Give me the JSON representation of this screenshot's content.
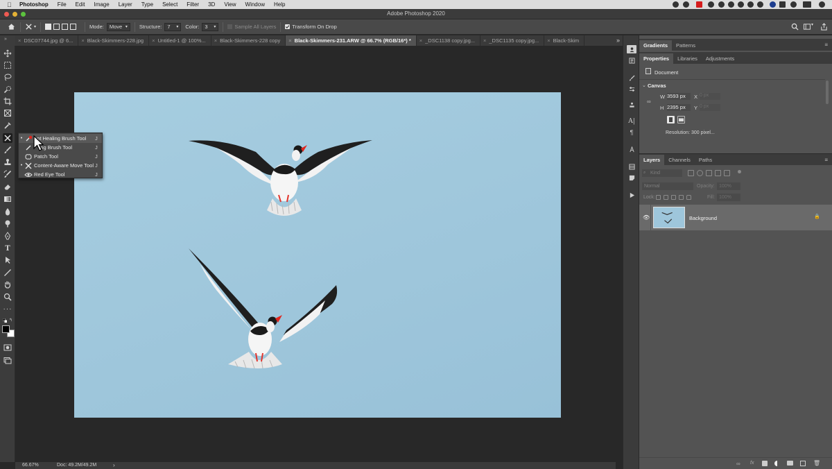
{
  "menubar": {
    "app_name": "Photoshop",
    "items": [
      "File",
      "Edit",
      "Image",
      "Layer",
      "Type",
      "Select",
      "Filter",
      "3D",
      "View",
      "Window",
      "Help"
    ]
  },
  "window": {
    "title": "Adobe Photoshop 2020"
  },
  "options": {
    "mode_label": "Mode:",
    "mode_value": "Move",
    "structure_label": "Structure:",
    "structure_value": "7",
    "color_label": "Color:",
    "color_value": "3",
    "sample_all_layers": "Sample All Layers",
    "transform_on_drop": "Transform On Drop"
  },
  "tabs": [
    {
      "label": "DSC07744.jpg @ 6..."
    },
    {
      "label": "Black-Skimmers-228.jpg"
    },
    {
      "label": "Untitled-1 @ 100%..."
    },
    {
      "label": "Black-Skimmers-228 copy"
    },
    {
      "label": "Black-Skimmers-231.ARW @ 66.7% (RGB/16*) *"
    },
    {
      "label": "_DSC1138 copy.jpg..."
    },
    {
      "label": "_DSC1135 copy.jpg..."
    },
    {
      "label": "Black-Skim"
    }
  ],
  "flyout": {
    "items": [
      {
        "label": "Spot Healing Brush Tool",
        "visible_text": "pot Healing Brush Tool",
        "key": "J",
        "selected": true,
        "icon": "spot-healing-icon"
      },
      {
        "label": "Healing Brush Tool",
        "visible_text": "ling Brush Tool",
        "key": "J",
        "selected": false,
        "icon": "healing-brush-icon"
      },
      {
        "label": "Patch Tool",
        "visible_text": "Patch Tool",
        "key": "J",
        "selected": false,
        "icon": "patch-icon"
      },
      {
        "label": "Content-Aware Move Tool",
        "visible_text": "Content-Aware Move Tool",
        "key": "J",
        "selected": true,
        "icon": "content-aware-move-icon"
      },
      {
        "label": "Red Eye Tool",
        "visible_text": "Red Eye Tool",
        "key": "J",
        "selected": false,
        "icon": "red-eye-icon"
      }
    ]
  },
  "status": {
    "zoom": "66.67%",
    "doc": "Doc: 49.2M/49.2M"
  },
  "panels": {
    "top_tabs": [
      "Gradients",
      "Patterns"
    ],
    "properties_tabs": [
      "Properties",
      "Libraries",
      "Adjustments"
    ],
    "document_label": "Document",
    "canvas_header": "Canvas",
    "width_label": "W",
    "width_value": "3593 px",
    "height_label": "H",
    "height_value": "2395 px",
    "x_label": "X",
    "y_label": "Y",
    "x_placeholder": "0 px",
    "y_placeholder": "0 px",
    "resolution": "Resolution: 300 pixel...",
    "layers_tabs": [
      "Layers",
      "Channels",
      "Paths"
    ],
    "kind_placeholder": "Kind",
    "blend_mode": "Normal",
    "opacity_label": "Opacity:",
    "opacity_value": "100%",
    "lock_label": "Lock:",
    "fill_label": "Fill:",
    "fill_value": "100%",
    "layer_name": "Background"
  },
  "colors": {
    "sky": "#9ec6db",
    "accent_red": "#e0261e",
    "panel_bg": "#535353",
    "selected_layer": "#6a6a6a"
  }
}
